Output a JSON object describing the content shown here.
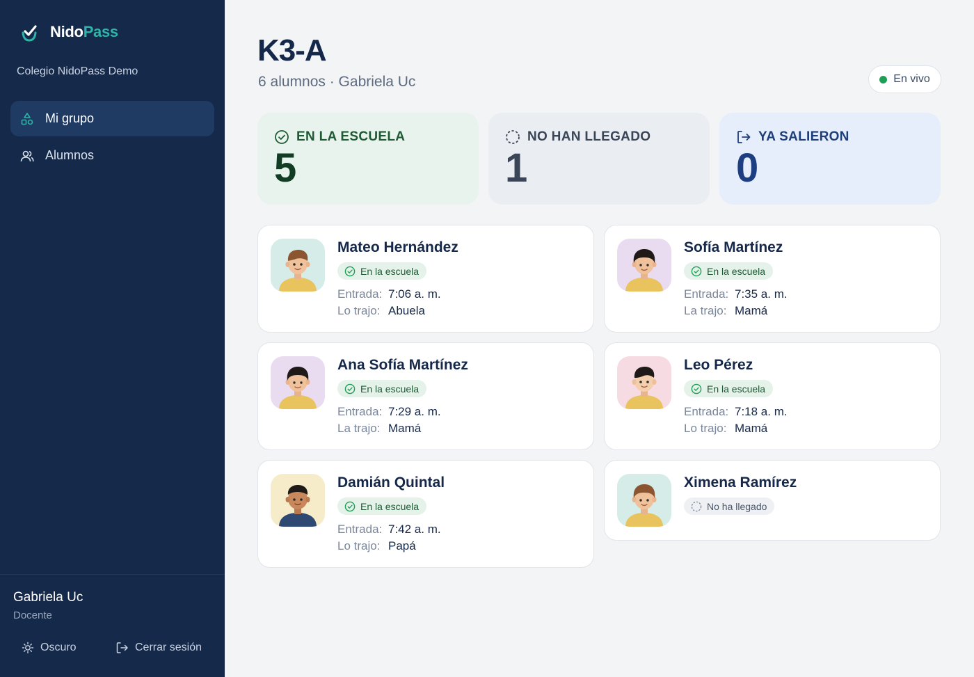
{
  "brand": {
    "name_a": "Nido",
    "name_b": "Pass",
    "accent": "#2fb5a7"
  },
  "school": "Colegio NidoPass Demo",
  "nav": [
    {
      "label": "Mi grupo",
      "icon": "shapes-icon",
      "active": true
    },
    {
      "label": "Alumnos",
      "icon": "users-icon",
      "active": false
    }
  ],
  "user": {
    "name": "Gabriela Uc",
    "role": "Docente"
  },
  "footer": {
    "theme_label": "Oscuro",
    "logout_label": "Cerrar sesión"
  },
  "page": {
    "title": "K3-A",
    "subtitle": "6 alumnos · Gabriela Uc",
    "live_label": "En vivo"
  },
  "stats": [
    {
      "label": "EN LA ESCUELA",
      "value": "5",
      "icon": "check-circle-icon",
      "color": "#1e5a33"
    },
    {
      "label": "NO HAN LLEGADO",
      "value": "1",
      "icon": "dashed-circle-icon",
      "color": "#3a4658"
    },
    {
      "label": "YA SALIERON",
      "value": "0",
      "icon": "logout-arrow-icon",
      "color": "#1e3e82"
    }
  ],
  "labels": {
    "entry": "Entrada:",
    "brought_o": "Lo trajo:",
    "brought_a": "La trajo:"
  },
  "students": [
    {
      "name": "Mateo Hernández",
      "status": "En la escuela",
      "entry_label": "Entrada:",
      "entry": "7:06 a. m.",
      "brought_label": "Lo trajo:",
      "brought": "Abuela"
    },
    {
      "name": "Sofía Martínez",
      "status": "En la escuela",
      "entry_label": "Entrada:",
      "entry": "7:35 a. m.",
      "brought_label": "La trajo:",
      "brought": "Mamá"
    },
    {
      "name": "Ana Sofía Martínez",
      "status": "En la escuela",
      "entry_label": "Entrada:",
      "entry": "7:29 a. m.",
      "brought_label": "La trajo:",
      "brought": "Mamá"
    },
    {
      "name": "Leo Pérez",
      "status": "En la escuela",
      "entry_label": "Entrada:",
      "entry": "7:18 a. m.",
      "brought_label": "Lo trajo:",
      "brought": "Mamá"
    },
    {
      "name": "Damián Quintal",
      "status": "En la escuela",
      "entry_label": "Entrada:",
      "entry": "7:42 a. m.",
      "brought_label": "Lo trajo:",
      "brought": "Papá"
    },
    {
      "name": "Ximena Ramírez",
      "status": "No ha llegado"
    }
  ]
}
